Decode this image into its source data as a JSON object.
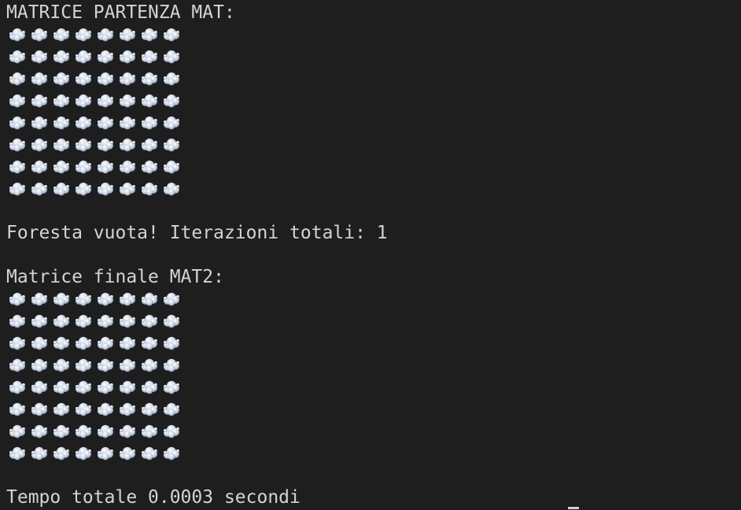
{
  "terminal": {
    "title_mat": "MATRICE PARTENZA MAT:",
    "message": "Foresta vuota! Iterazioni totali: 1",
    "title_mat2": "Matrice finale MAT2:",
    "time": "Tempo totale 0.0003 secondi"
  },
  "matrix_mat": {
    "rows": 8,
    "cols": 8,
    "cell_icon": "cloud-icon"
  },
  "matrix_mat2": {
    "rows": 8,
    "cols": 8,
    "cell_icon": "cloud-icon"
  },
  "colors": {
    "background": "#1e1e1e",
    "text": "#d4d4d4"
  }
}
